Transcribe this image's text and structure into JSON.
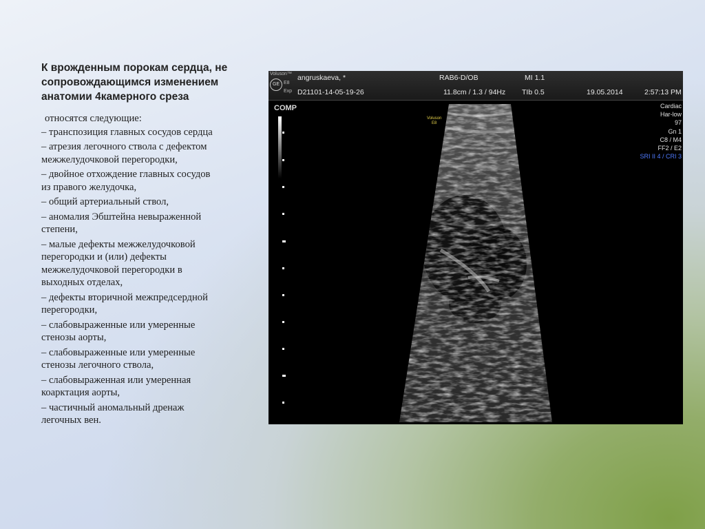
{
  "slide": {
    "title_lines": [
      "К врожденным порокам сердца, не",
      "сопровождающимся изменением",
      "анатомии 4камерного среза"
    ],
    "intro": "относятся следующие:",
    "items": [
      [
        "– транспозиция главных сосудов сердца"
      ],
      [
        " – атрезия легочного ствола с дефектом",
        "межжелудочковой перегородки,"
      ],
      [
        "– двойное отхождение главных сосудов",
        "из правого желудочка,"
      ],
      [
        "– общий артериальный ствол,"
      ],
      [
        "– аномалия Эбштейна невыраженной",
        "степени,"
      ],
      [
        "– малые дефекты межжелудочковой",
        "перегородки и (или) дефекты",
        "межжелудочковой перегородки в",
        "выходных отделах,"
      ],
      [
        "– дефекты вторичной межпредсердной",
        "перегородки,"
      ],
      [
        "– слабовыраженные или умеренные",
        "стенозы аорты,"
      ],
      [
        "– слабовыраженные или умеренные",
        "стенозы легочного ствола,"
      ],
      [
        "– слабовыраженная или умеренная",
        "коарктация аорты,"
      ],
      [
        "– частичный аномальный дренаж",
        "легочных вен."
      ]
    ]
  },
  "ultrasound": {
    "brand": "Voluson™",
    "logo": "GE",
    "model": "E8",
    "exp": "Exp",
    "patient": "angruskaeva, *",
    "probe": "RAB6-D/OB",
    "mi": "MI 1.1",
    "exam_id": "D21101-14-05-19-26",
    "settings": "11.8cm / 1.3 / 94Hz",
    "tib": "TIb 0.5",
    "date": "19.05.2014",
    "time": "2:57:13 PM",
    "mode": "COMP",
    "probe_brand_lines": [
      "Voluson",
      "E8"
    ],
    "params": [
      "Cardiac",
      "Har-low",
      "97",
      "Gn  1",
      "C8 / M4",
      "FF2 / E2"
    ],
    "params_highlight": "SRI II 4 / CRI 3"
  }
}
